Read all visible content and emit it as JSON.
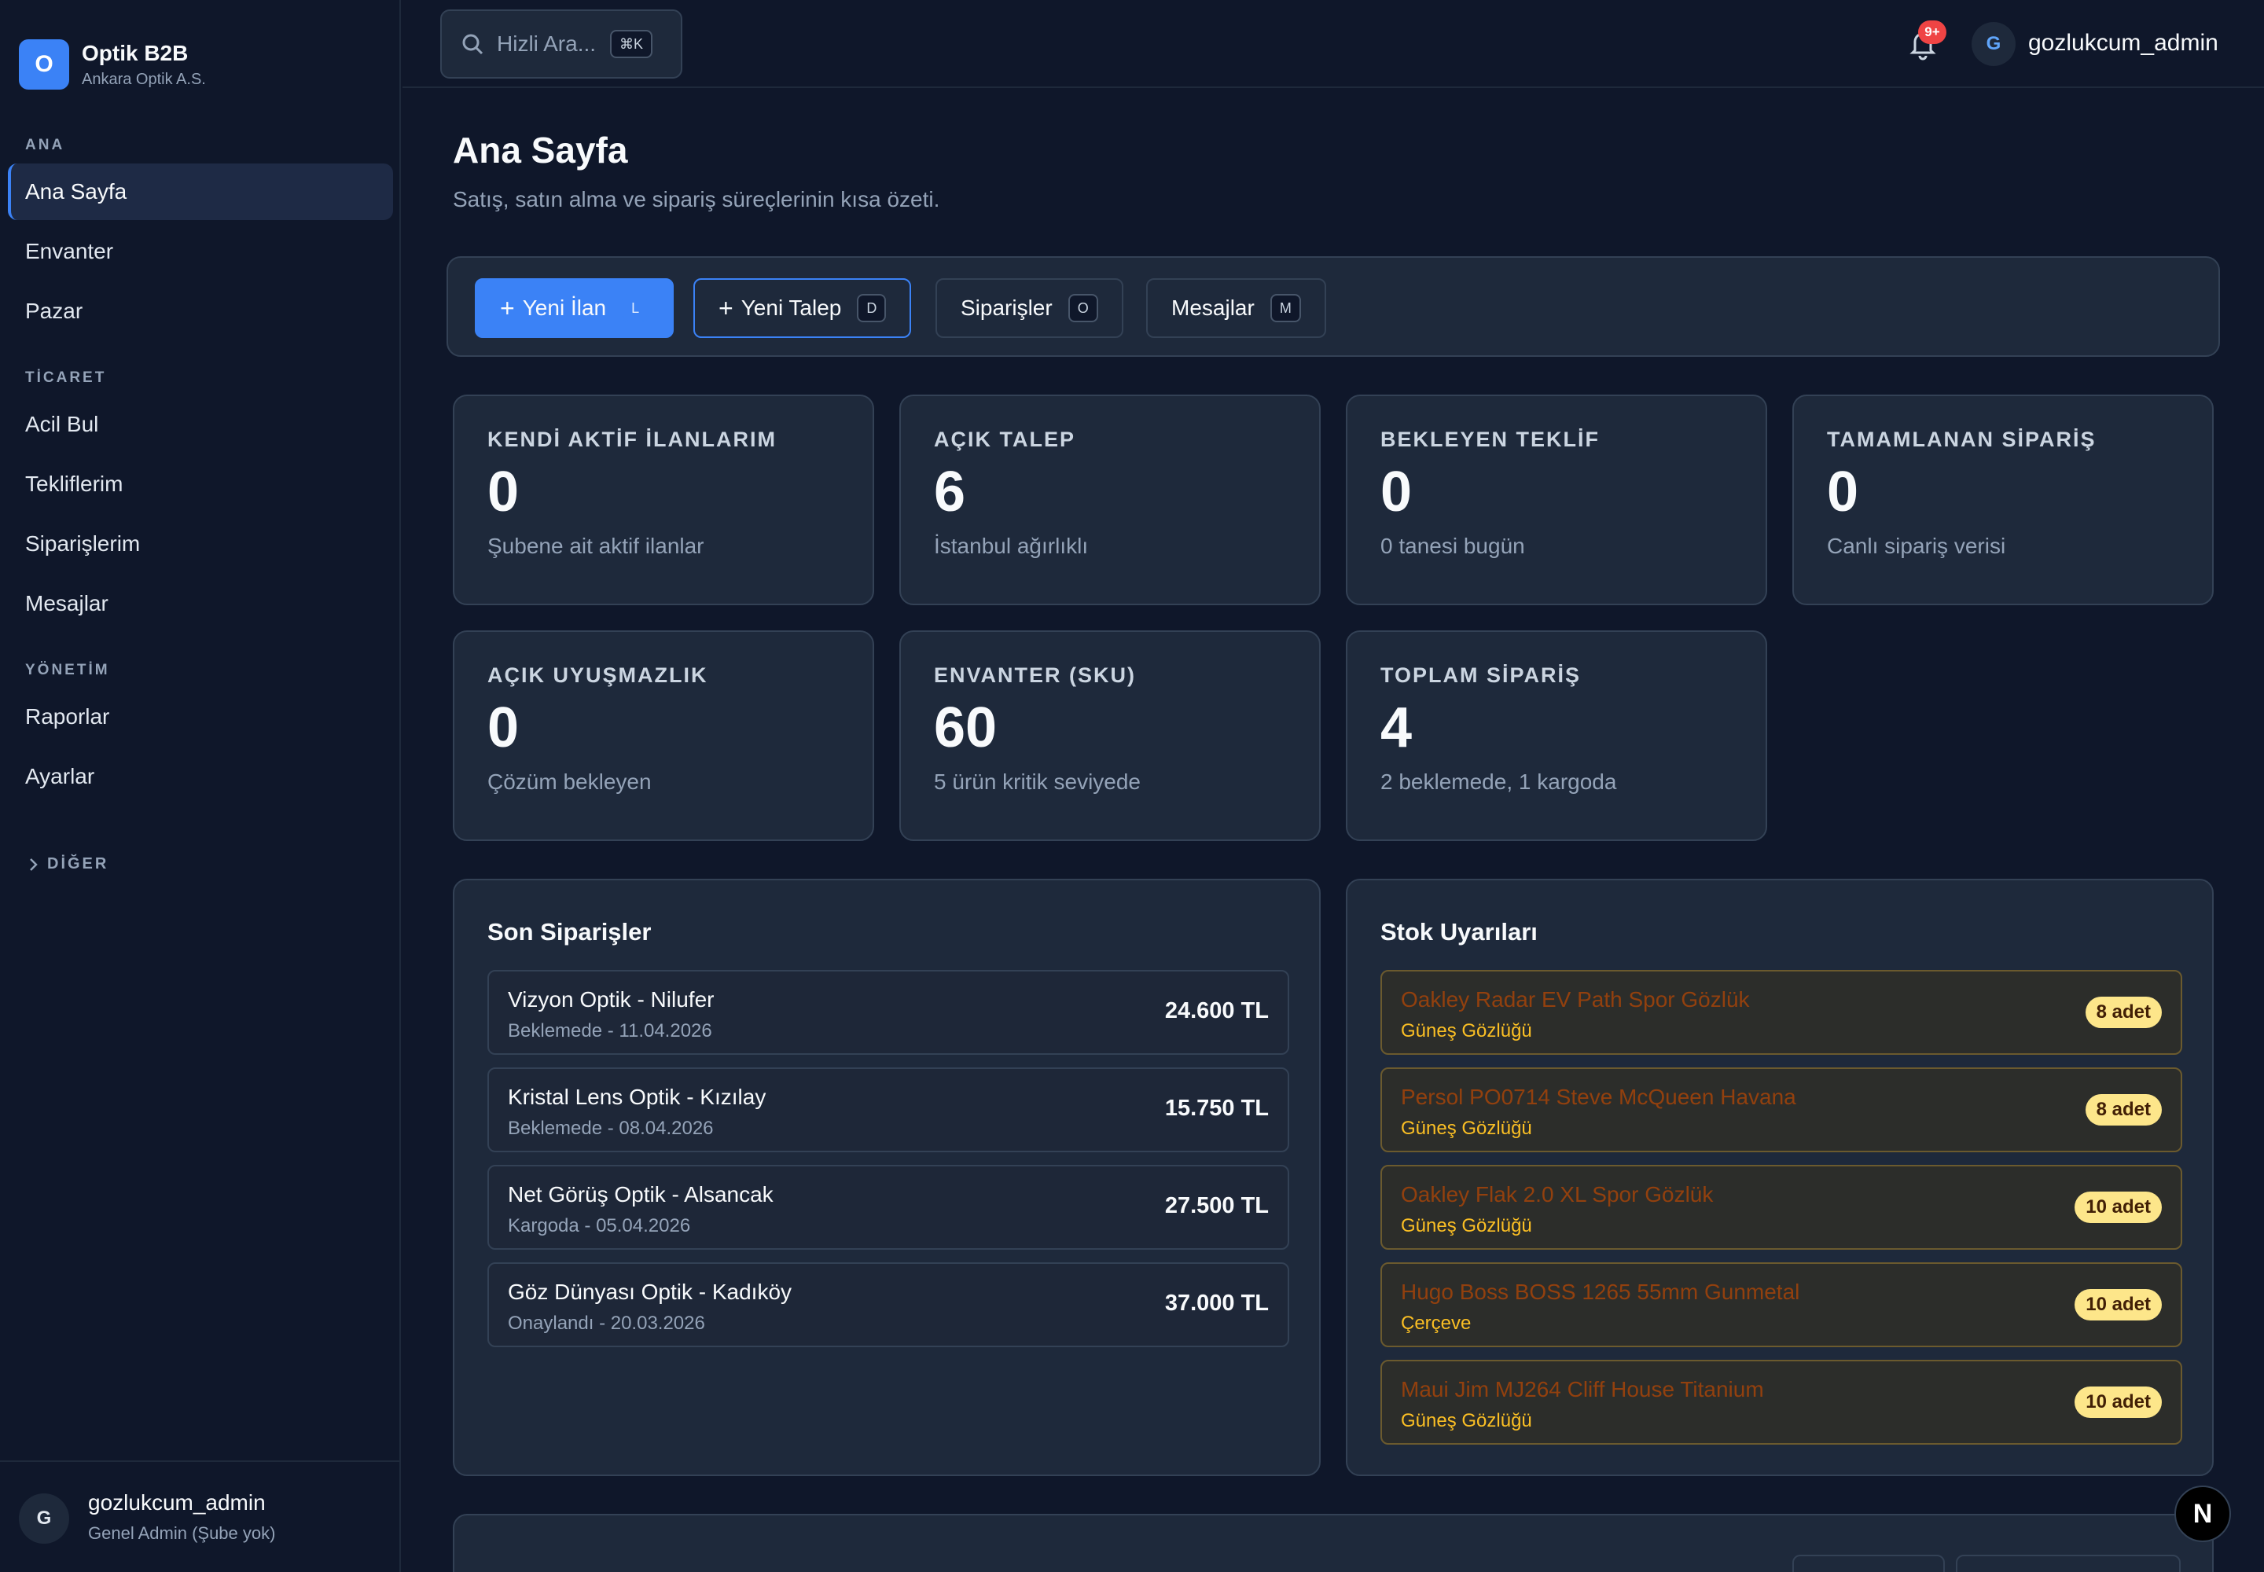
{
  "brand": {
    "logo_letter": "O",
    "name": "Optik B2B",
    "company": "Ankara Optik A.S."
  },
  "sidebar": {
    "sections": [
      {
        "label": "ANA"
      },
      {
        "label": "TİCARET"
      },
      {
        "label": "YÖNETİM"
      }
    ],
    "items": [
      {
        "label": "Ana Sayfa",
        "active": true
      },
      {
        "label": "Envanter"
      },
      {
        "label": "Pazar"
      },
      {
        "label": "Acil Bul"
      },
      {
        "label": "Tekliflerim"
      },
      {
        "label": "Siparişlerim"
      },
      {
        "label": "Mesajlar"
      },
      {
        "label": "Raporlar"
      },
      {
        "label": "Ayarlar"
      }
    ],
    "other_label": "DİĞER",
    "footer": {
      "avatar_letter": "G",
      "name": "gozlukcum_admin",
      "role": "Genel Admin (Şube yok)"
    }
  },
  "topbar": {
    "search_placeholder": "Hizli Ara...",
    "search_shortcut": "⌘K",
    "notification_badge": "9+",
    "avatar_letter": "G",
    "username": "gozlukcum_admin"
  },
  "page": {
    "title": "Ana Sayfa",
    "subtitle": "Satış, satın alma ve sipariş süreçlerinin kısa özeti."
  },
  "actions": [
    {
      "label": "Yeni İlan",
      "shortcut": "L",
      "plus": "+"
    },
    {
      "label": "Yeni Talep",
      "shortcut": "D",
      "plus": "+"
    },
    {
      "label": "Siparişler",
      "shortcut": "O"
    },
    {
      "label": "Mesajlar",
      "shortcut": "M"
    }
  ],
  "stats": [
    {
      "label": "KENDİ AKTİF İLANLARIM",
      "value": "0",
      "note": "Şubene ait aktif ilanlar"
    },
    {
      "label": "AÇIK TALEP",
      "value": "6",
      "note": "İstanbul ağırlıklı"
    },
    {
      "label": "BEKLEYEN TEKLİF",
      "value": "0",
      "note": "0 tanesi bugün"
    },
    {
      "label": "TAMAMLANAN SİPARİŞ",
      "value": "0",
      "note": "Canlı sipariş verisi"
    },
    {
      "label": "AÇIK UYUŞMAZLIK",
      "value": "0",
      "note": "Çözüm bekleyen"
    },
    {
      "label": "ENVANTER (SKU)",
      "value": "60",
      "note": "5 ürün kritik seviyede"
    },
    {
      "label": "TOPLAM SİPARİŞ",
      "value": "4",
      "note": "2 beklemede, 1 kargoda"
    }
  ],
  "recent_orders": {
    "title": "Son Siparişler",
    "rows": [
      {
        "name": "Vizyon Optik - Nilufer",
        "status": "Beklemede - 11.04.2026",
        "amount": "24.600 TL"
      },
      {
        "name": "Kristal Lens Optik - Kızılay",
        "status": "Beklemede - 08.04.2026",
        "amount": "15.750 TL"
      },
      {
        "name": "Net Görüş Optik - Alsancak",
        "status": "Kargoda - 05.04.2026",
        "amount": "27.500 TL"
      },
      {
        "name": "Göz Dünyası Optik - Kadıköy",
        "status": "Onaylandı - 20.03.2026",
        "amount": "37.000 TL"
      }
    ]
  },
  "stock_alerts": {
    "title": "Stok Uyarıları",
    "rows": [
      {
        "name": "Oakley Radar EV Path Spor Gözlük",
        "category": "Güneş Gözlüğü",
        "qty": "8 adet"
      },
      {
        "name": "Persol PO0714 Steve McQueen Havana",
        "category": "Güneş Gözlüğü",
        "qty": "8 adet"
      },
      {
        "name": "Oakley Flak 2.0 XL Spor Gözlük",
        "category": "Güneş Gözlüğü",
        "qty": "10 adet"
      },
      {
        "name": "Hugo Boss BOSS 1265 55mm Gunmetal",
        "category": "Çerçeve",
        "qty": "10 adet"
      },
      {
        "name": "Maui Jim MJ264 Cliff House Titanium",
        "category": "Güneş Gözlüğü",
        "qty": "10 adet"
      }
    ]
  },
  "colors": {
    "accent": "#3b82f6",
    "background": "#0f172a",
    "card": "#1e293b",
    "warning": "#fbbf24",
    "danger": "#ef4444"
  },
  "dev_badge_letter": "N"
}
